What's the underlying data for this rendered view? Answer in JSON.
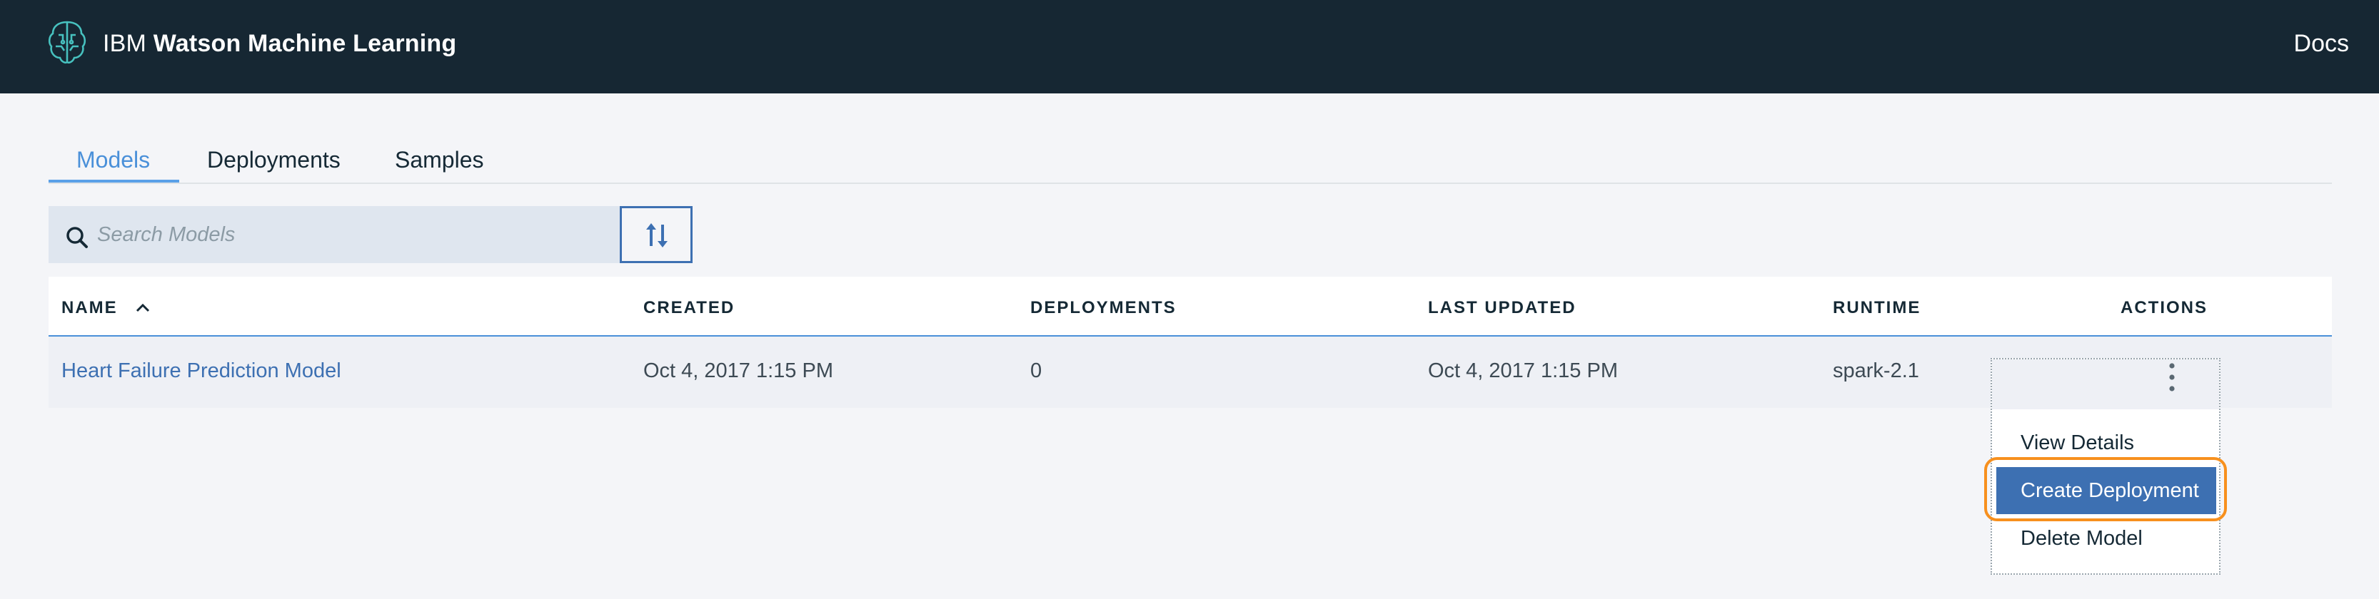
{
  "header": {
    "brand_prefix": "IBM",
    "brand_product": "Watson Machine Learning",
    "docs_link": "Docs",
    "logo_icon": "watson-brain-icon"
  },
  "tabs": [
    {
      "label": "Models",
      "active": true
    },
    {
      "label": "Deployments",
      "active": false
    },
    {
      "label": "Samples",
      "active": false
    }
  ],
  "search": {
    "placeholder": "Search Models",
    "value": "",
    "icon": "search-icon"
  },
  "sort_button": {
    "icon": "sort-arrows-icon"
  },
  "table": {
    "columns": [
      "NAME",
      "CREATED",
      "DEPLOYMENTS",
      "LAST UPDATED",
      "RUNTIME",
      "ACTIONS"
    ],
    "sort": {
      "column": "NAME",
      "direction": "ascending",
      "icon": "chevron-up-icon"
    },
    "rows": [
      {
        "name": "Heart Failure Prediction Model",
        "created": "Oct 4, 2017 1:15 PM",
        "deployments": "0",
        "last_updated": "Oct 4, 2017 1:15 PM",
        "runtime": "spark-2.1"
      }
    ]
  },
  "overflow_menu": {
    "icon": "kebab-menu-icon",
    "items": [
      {
        "label": "View Details",
        "highlighted": false
      },
      {
        "label": "Create Deployment",
        "highlighted": true
      },
      {
        "label": "Delete Model",
        "highlighted": false
      }
    ]
  },
  "colors": {
    "header_bg": "#162733",
    "accent_blue": "#3d70b2",
    "active_tab": "#4a90d9",
    "highlight_ring": "#f7901e"
  }
}
